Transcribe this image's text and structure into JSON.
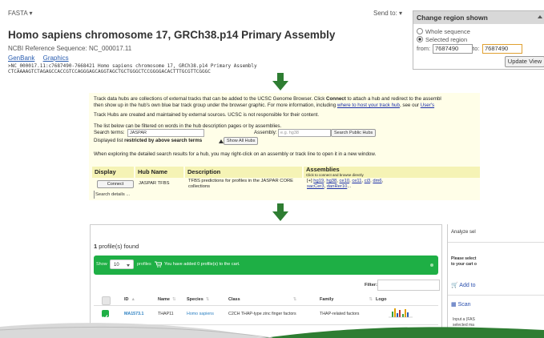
{
  "ncbi": {
    "fasta_menu": "FASTA ▾",
    "send_to": "Send to: ▾",
    "title": "Homo sapiens chromosome 17, GRCh38.p14 Primary Assembly",
    "reference": "NCBI Reference Sequence: NC_000017.11",
    "links": [
      "GenBank",
      "Graphics"
    ],
    "sequence_header": ">NC_000017.11:c7687490-7668421 Homo sapiens chromosome 17, GRCh38.p14 Primary Assembly",
    "sequence_line": "CTCAAAAGTCTAGAGCCACCGTCCAGGGAGCAGGTAGCTGCTGGGCTCCGGGGACACTTTGCGTTCGGGC",
    "change_region": {
      "title": "Change region shown",
      "option_whole": "Whole sequence",
      "option_selected": "Selected region",
      "from_label": "from:",
      "from_value": "7687490",
      "to_label": "to:",
      "to_value": "7687490",
      "update_button": "Update View"
    }
  },
  "ucsc": {
    "intro_1a": "Track data hubs are collections of external tracks that can be added to the UCSC Genome Browser. Click ",
    "intro_1b": "Connect",
    "intro_1c": " to attach a hub and redirect to the assembl",
    "intro_2a": "then show up in the hub's own blue bar track group under the browser graphic. For more information, including ",
    "intro_2b": "where to host your track hub",
    "intro_2c": ", see our ",
    "intro_2d": "User's",
    "disclaimer": "Track Hubs are created and maintained by external sources. UCSC is not responsible for their content.",
    "filter_note": "The list below can be filtered on words in the hub description pages or by assemblies.",
    "search_label": "Search terms:",
    "search_value": "JASPAR",
    "assembly_label": "Assembly:",
    "assembly_placeholder": "e.g. hg38",
    "search_button": "Search Public Hubs",
    "displayed_a": "Displayed list ",
    "displayed_b": "restricted by above search terms",
    "show_all_button": "Show All Hubs",
    "explore_note": "When exploring the detailed search results for a hub, you may right-click on an assembly or track line to open it in a new window.",
    "table": {
      "headers": [
        "Display",
        "Hub Name",
        "Description",
        "Assemblies"
      ],
      "assemblies_sub": "Click to connect and browse directly",
      "row": {
        "button": "Connect",
        "hub_name": "JASPAR TFBS",
        "description_1": "TFBS predictions for profiles in the JASPAR CORE",
        "description_2": "collections",
        "assemblies_1a": "[+] ",
        "assemblies_1_links": [
          "hg19",
          "hg38",
          "ce10",
          "ce11",
          "ci3",
          "dm6"
        ],
        "assemblies_2_links": [
          "sacCer3",
          "danRer10"
        ],
        "assemblies_2_suffix": "..."
      }
    },
    "search_details": "Search details ..."
  },
  "jaspar": {
    "found_count": "1",
    "found_label": "profile(s) found",
    "show_label": "Show",
    "page_size": "10",
    "profiles_label": "profiles",
    "cart_message": "You have added 0 profile(s) to the cart.",
    "filter_label": "Filter:",
    "headers": [
      "ID",
      "Name",
      "Species",
      "Class",
      "Family",
      "Logo"
    ],
    "row": {
      "id": "MA1573.1",
      "name": "THAP11",
      "species": "Homo sapiens",
      "class": "C2CH THAP-type zinc finger factors",
      "family": "THAP-related factors"
    },
    "footer": "Showing 1 to 1 of 1 entries",
    "right": {
      "heading": "Analyze sel",
      "desc_1": "Please select",
      "desc_2": "to your cart o",
      "add_label": "Add to",
      "scan_label": "Scan",
      "input_1": "Input a (FAS",
      "input_2": "selected ma"
    }
  },
  "colors": {
    "arrow": "#2e7d32",
    "jaspar_green": "#1eaf45",
    "ucsc_bg": "#fffee8",
    "link_blue": "#2a5db0"
  }
}
